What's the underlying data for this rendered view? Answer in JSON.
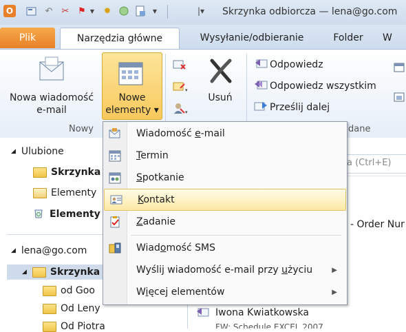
{
  "window": {
    "title": "Skrzynka odbiorcza — lena@go.com"
  },
  "tabs": [
    {
      "label": "Plik"
    },
    {
      "label": "Narzędzia główne"
    },
    {
      "label": "Wysyłanie/odbieranie"
    },
    {
      "label": "Folder"
    },
    {
      "label": "W"
    }
  ],
  "ribbon": {
    "new_email": {
      "line1": "Nowa wiadomość",
      "line2": "e-mail"
    },
    "new_items": {
      "line1": "Nowe",
      "line2": "elementy ▾"
    },
    "delete": {
      "label": "Usuń"
    },
    "reply": {
      "label": "Odpowiedz"
    },
    "reply_all": {
      "label": "Odpowiedz wszystkim"
    },
    "forward": {
      "label": "Prześlij dalej"
    },
    "group_new": "Nowy",
    "group_respond": "dane"
  },
  "nav": {
    "favorites": "Ulubione",
    "fav_inbox": "Skrzynka",
    "fav_sent": "Elementy",
    "fav_deleted": "Elementy",
    "account": "lena@go.com",
    "inbox": "Skrzynka",
    "sub1": "od Goo",
    "sub2": "Od Leny",
    "sub3": "Od Piotra"
  },
  "right": {
    "search_placeholder": "a (Ctrl+E)",
    "order_text": "- Order Nur",
    "sender": "Iwona Kwiatkowska",
    "subject_cut": "FW: Schedule EXCEL 2007"
  },
  "menu": {
    "items": [
      {
        "pre": "Wiadomość ",
        "acc": "e",
        "post": "-mail"
      },
      {
        "pre": "",
        "acc": "T",
        "post": "ermin"
      },
      {
        "pre": "",
        "acc": "S",
        "post": "potkanie"
      },
      {
        "pre": "",
        "acc": "K",
        "post": "ontakt"
      },
      {
        "pre": "",
        "acc": "Z",
        "post": "adanie"
      },
      {
        "pre": "Wiad",
        "acc": "o",
        "post": "mość SMS"
      },
      {
        "pre": "Wyślij wiadomość e-mail przy ",
        "acc": "u",
        "post": "życiu"
      },
      {
        "pre": "W",
        "acc": "i",
        "post": "ęcej elementów"
      }
    ]
  },
  "colors": {
    "file_tab": "#e8802a",
    "highlight": "#fde9a6",
    "ribbon_bg": "#e6eef8"
  }
}
